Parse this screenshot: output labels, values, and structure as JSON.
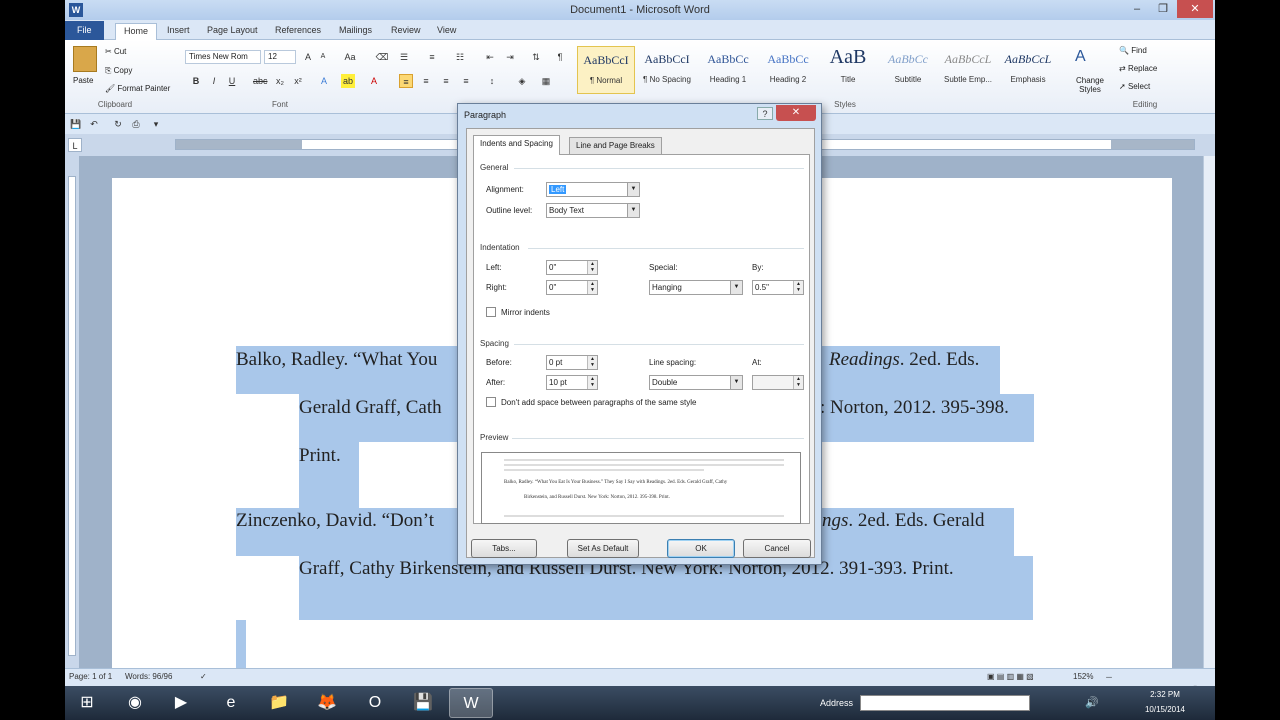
{
  "window": {
    "title": "Document1 - Microsoft Word"
  },
  "ribbon_tabs": [
    "File",
    "Home",
    "Insert",
    "Page Layout",
    "References",
    "Mailings",
    "Review",
    "View"
  ],
  "clipboard": {
    "paste": "Paste",
    "cut": "Cut",
    "copy": "Copy",
    "format_painter": "Format Painter",
    "label": "Clipboard"
  },
  "font": {
    "name": "Times New Rom",
    "size": "12",
    "label": "Font"
  },
  "paragraph_label": "Paragraph",
  "styles": [
    {
      "preview": "AaBbCcI",
      "name": "¶ Normal"
    },
    {
      "preview": "AaBbCcI",
      "name": "¶ No Spacing"
    },
    {
      "preview": "AaBbCc",
      "name": "Heading 1"
    },
    {
      "preview": "AaBbCc",
      "name": "Heading 2"
    },
    {
      "preview": "AaB",
      "name": "Title"
    },
    {
      "preview": "AaBbCc",
      "name": "Subtitle"
    },
    {
      "preview": "AaBbCcL",
      "name": "Subtle Emp..."
    },
    {
      "preview": "AaBbCcL",
      "name": "Emphasis"
    }
  ],
  "styles_label": "Styles",
  "change_styles": "Change Styles",
  "editing": {
    "find": "Find",
    "replace": "Replace",
    "select": "Select",
    "label": "Editing"
  },
  "document": {
    "line1a": "Balko, Radley. “What You",
    "line1b": "Readings",
    "line1c": ". 2ed. Eds.",
    "line2a": "Gerald Graff, Cath",
    "line2b": ": Norton, 2012. 395-398.",
    "line3": "Print.",
    "line4a": "Zinczenko, David. “Don’t",
    "line4b": "ngs",
    "line4c": ". 2ed. Eds. Gerald",
    "line5a": "Graff, Cathy Birkenstein, and Russell Durst.",
    "line5b": " New York: Norton, 2012. 391-393. Print."
  },
  "status": {
    "page": "Page: 1 of 1",
    "words": "Words: 96/96",
    "zoom": "152%"
  },
  "taskbar": {
    "address_label": "Address",
    "time": "2:32 PM",
    "date": "10/15/2014"
  },
  "dialog": {
    "title": "Paragraph",
    "tab_indents": "Indents and Spacing",
    "tab_breaks": "Line and Page Breaks",
    "general": "General",
    "alignment_label": "Alignment:",
    "alignment_value": "Left",
    "outline_label": "Outline level:",
    "outline_value": "Body Text",
    "indentation": "Indentation",
    "left_label": "Left:",
    "left_value": "0\"",
    "right_label": "Right:",
    "right_value": "0\"",
    "special_label": "Special:",
    "special_value": "Hanging",
    "by_label": "By:",
    "by_value": "0.5\"",
    "mirror_label": "Mirror indents",
    "spacing": "Spacing",
    "before_label": "Before:",
    "before_value": "0 pt",
    "after_label": "After:",
    "after_value": "10 pt",
    "line_spacing_label": "Line spacing:",
    "line_spacing_value": "Double",
    "at_label": "At:",
    "at_value": "",
    "dont_add_label": "Don't add space between paragraphs of the same style",
    "preview": "Preview",
    "preview_text1": "Balko, Radley. “What You Eat Is Your Business.” They Say I Say with Readings. 2ed. Eds. Gerald Graff, Cathy",
    "preview_text2": "Birkenstein, and Russell Durst. New York: Norton, 2012. 395-398. Print.",
    "tabs_btn": "Tabs...",
    "default_btn": "Set As Default",
    "ok_btn": "OK",
    "cancel_btn": "Cancel"
  }
}
